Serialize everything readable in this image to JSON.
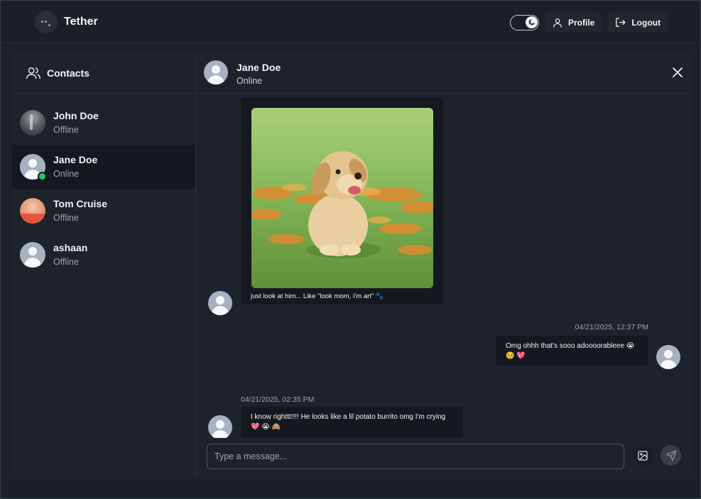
{
  "app": {
    "name": "Tether"
  },
  "navbar": {
    "profile_label": "Profile",
    "logout_label": "Logout"
  },
  "sidebar": {
    "title": "Contacts",
    "contacts": [
      {
        "name": "John Doe",
        "status": "Offline",
        "avatar": "photo",
        "active": false
      },
      {
        "name": "Jane Doe",
        "status": "Online",
        "avatar": "default",
        "active": true
      },
      {
        "name": "Tom Cruise",
        "status": "Offline",
        "avatar": "photo",
        "active": false
      },
      {
        "name": "ashaan",
        "status": "Offline",
        "avatar": "default",
        "active": false
      }
    ]
  },
  "chat": {
    "contact_name": "Jane Doe",
    "contact_status": "Online",
    "messages": [
      {
        "from": "them",
        "image": "puppy-photo",
        "text": "just look at him... Like \"look mom, I'm art\" 🐾"
      },
      {
        "from": "me",
        "time": "04/21/2025, 12:37 PM",
        "text": "Omg ohhh that's sooo adoooorableee 😭 🥺 💖"
      },
      {
        "from": "them",
        "time": "04/21/2025, 02:35 PM",
        "text": "I know righttt!!!! He looks like a lil potato burrito omg I'm crying 💖 😭 🙈"
      }
    ],
    "composer": {
      "placeholder": "Type a message..."
    }
  },
  "colors": {
    "background": "#1c2129",
    "panel": "#1e232b",
    "bubble": "#15191f",
    "online": "#22c55e"
  },
  "icons": {
    "theme": "moon-icon",
    "profile": "user-icon",
    "logout": "logout-icon",
    "contacts": "users-icon",
    "close": "close-icon",
    "image": "image-icon",
    "send": "send-icon"
  }
}
